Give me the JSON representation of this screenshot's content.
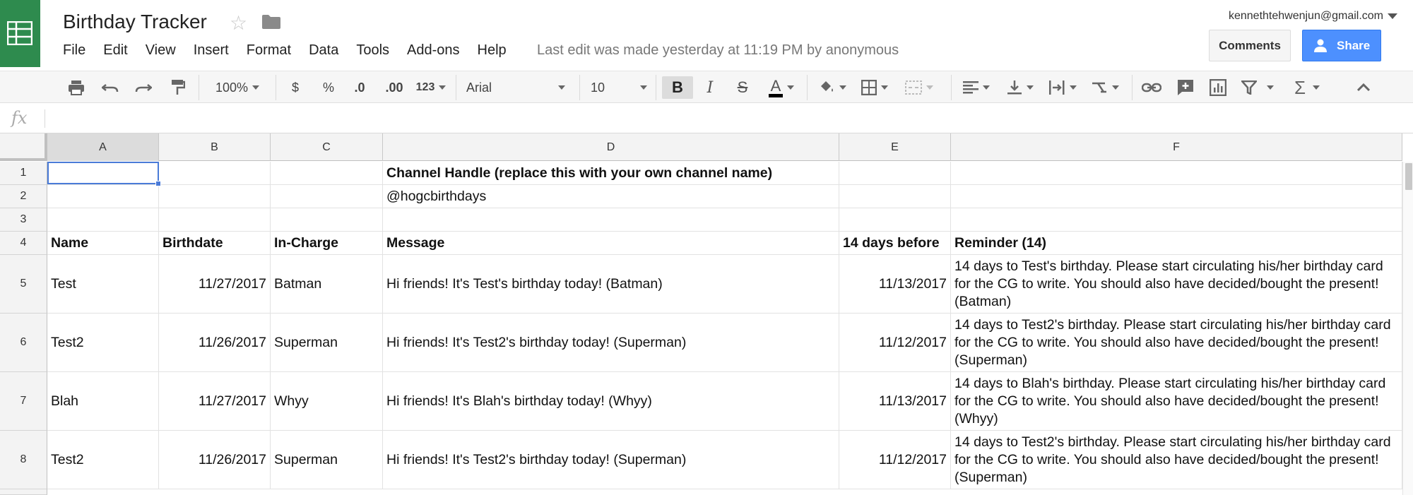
{
  "app": {
    "title": "Birthday Tracker",
    "account": "kennethtehwenjun@gmail.com",
    "last_edit": "Last edit was made yesterday at 11:19 PM by anonymous",
    "comments_label": "Comments",
    "share_label": "Share",
    "brand_color": "#2e8b4e",
    "accent_color": "#4d90fe"
  },
  "menu": [
    "File",
    "Edit",
    "View",
    "Insert",
    "Format",
    "Data",
    "Tools",
    "Add-ons",
    "Help"
  ],
  "toolbar": {
    "zoom": "100%",
    "currency": "$",
    "percent": "%",
    "decrease_decimal": ".0",
    "increase_decimal": ".00",
    "more_formats": "123",
    "font": "Arial",
    "font_size": "10",
    "bold": "B",
    "italic": "I",
    "strike": "S",
    "text_color": "A"
  },
  "formula": {
    "label": "fx",
    "value": ""
  },
  "columns": [
    "A",
    "B",
    "C",
    "D",
    "E",
    "F"
  ],
  "rows": [
    {
      "num": "1",
      "cells": [
        "",
        "",
        "",
        "Channel Handle (replace this with your own channel name)",
        "",
        ""
      ]
    },
    {
      "num": "2",
      "cells": [
        "",
        "",
        "",
        "@hogcbirthdays",
        "",
        ""
      ]
    },
    {
      "num": "3",
      "cells": [
        "",
        "",
        "",
        "",
        "",
        ""
      ]
    },
    {
      "num": "4",
      "cells": [
        "Name",
        "Birthdate",
        "In-Charge",
        "Message",
        "14 days before",
        "Reminder (14)"
      ]
    },
    {
      "num": "5",
      "cells": [
        "Test",
        "11/27/2017",
        "Batman",
        "Hi friends! It's Test's birthday today! (Batman)",
        "11/13/2017",
        "14 days to Test's birthday. Please start circulating his/her birthday card for the CG to write. You should also have decided/bought the present! (Batman)"
      ]
    },
    {
      "num": "6",
      "cells": [
        "Test2",
        "11/26/2017",
        "Superman",
        "Hi friends! It's Test2's birthday today! (Superman)",
        "11/12/2017",
        "14 days to Test2's birthday. Please start circulating his/her birthday card for the CG to write. You should also have decided/bought the present! (Superman)"
      ]
    },
    {
      "num": "7",
      "cells": [
        "Blah",
        "11/27/2017",
        "Whyy",
        "Hi friends! It's Blah's birthday today! (Whyy)",
        "11/13/2017",
        "14 days to Blah's birthday. Please start circulating his/her birthday card for the CG to write. You should also have decided/bought the present! (Whyy)"
      ]
    },
    {
      "num": "8",
      "cells": [
        "Test2",
        "11/26/2017",
        "Superman",
        "Hi friends! It's Test2's birthday today! (Superman)",
        "11/12/2017",
        "14 days to Test2's birthday. Please start circulating his/her birthday card for the CG to write. You should also have decided/bought the present! (Superman)"
      ]
    }
  ],
  "selected_cell": "A1"
}
